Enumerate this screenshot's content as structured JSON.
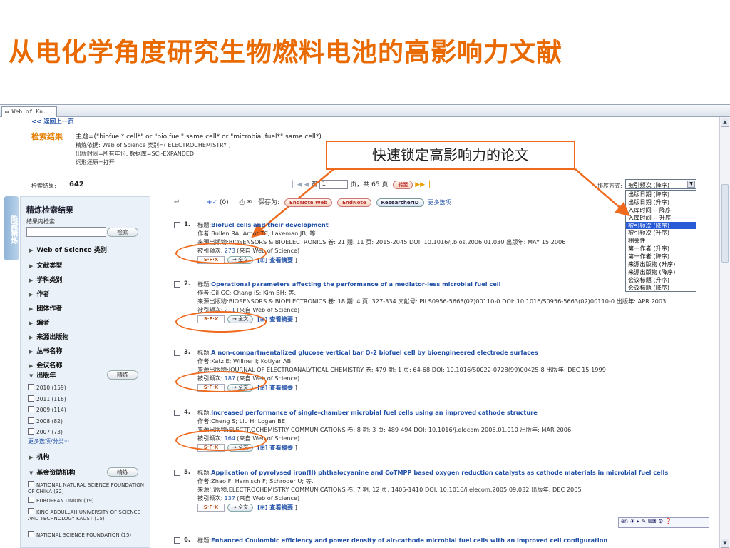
{
  "slide_title": "从电化学角度研究生物燃料电池的高影响力文献",
  "browser": {
    "tab_label": "Web of Kn..."
  },
  "back_link": "<< 返回上一页",
  "search_label": "检索结果",
  "query_line1": "主题=(\"biofuel* cell*\" or \"bio fuel\" same cell* or \"microbial fuel*\" same cell*)",
  "query_line2": "精炼依据: Web of Science 类别=( ELECTROCHEMISTRY )",
  "query_line3": "出版时间=所有年份. 数据库=SCI-EXPANDED.",
  "query_line4": "词形还原=打开",
  "results_label": "检索结果:",
  "results_count": "642",
  "pager": {
    "prefix": "第",
    "page": "1",
    "middle": "页，共 65 页",
    "go": "转至"
  },
  "sort_label": "排序方式:",
  "sort_selected": "被引频次 (降序)",
  "sort_options": [
    "出版日期 (降序)",
    "出版日期 (升序)",
    "入库时间 -- 降序",
    "入库时间 -- 升序",
    "被引频次 (降序)",
    "被引频次 (升序)",
    "相关性",
    "第一作者 (升序)",
    "第一作者 (降序)",
    "来源出版物 (升序)",
    "来源出版物 (降序)",
    "会议标题 (升序)",
    "会议标题 (降序)"
  ],
  "callout": "快速锁定高影响力的论文",
  "toolbar": {
    "count": "(0)",
    "save_label": "保存为:",
    "endnote_web": "EndNote Web",
    "endnote": "EndNote",
    "researcherid": "ResearcherID",
    "more": "更多选项"
  },
  "left_strip": "隐藏精炼",
  "refine": {
    "title": "精炼检索结果",
    "within_label": "结果内检索",
    "search_btn": "检索",
    "items": [
      "Web of Science 类别",
      "文献类型",
      "学科类别",
      "作者",
      "团体作者",
      "编者",
      "来源出版物",
      "丛书名称",
      "会议名称"
    ],
    "pubyear_label": "出版年",
    "refine_btn": "精炼",
    "years": [
      "2010 (159)",
      "2011 (116)",
      "2009 (114)",
      "2008 (82)",
      "2007 (73)"
    ],
    "more_options": "更多选项/分类···",
    "org_label": "机构",
    "funding_label": "基金资助机构",
    "funders": [
      "NATIONAL NATURAL SCIENCE FOUNDATION OF CHINA (32)",
      "EUROPEAN UNION (19)",
      "KING ABDULLAH UNIVERSITY OF SCIENCE AND TECHNOLOGY KAUST (15)",
      "NATIONAL SCIENCE FOUNDATION (15)"
    ]
  },
  "labels": {
    "title": "标题:",
    "author": "作者:",
    "source": "来源出版物:",
    "cited": "被引频次:",
    "cited_suffix": "(来自 Web of Science)",
    "fulltext": "全文",
    "abstract": "查看摘要"
  },
  "records": [
    {
      "num": "1.",
      "title": "Biofuel cells and their development",
      "authors": "Bullen RA; Arnot TC; Lakeman JB; 等.",
      "source": "BIOSENSORS & BIOELECTRONICS  卷: 21  期: 11  页: 2015-2045  DOI: 10.1016/j.bios.2006.01.030  出版年: MAY 15 2006",
      "cited": "273"
    },
    {
      "num": "2.",
      "title": "Operational parameters affecting the performance of a mediator-less microbial fuel cell",
      "authors": "Gil GC; Chang IS; Kim BH; 等.",
      "source": "BIOSENSORS & BIOELECTRONICS  卷: 18  期: 4  页: 327-334  文献号: PII S0956-5663(02)00110-0  DOI: 10.1016/S0956-5663(02)00110-0  出版年: APR 2003",
      "cited": "211"
    },
    {
      "num": "3.",
      "title": "A non-compartmentalized glucose vertical bar O-2 biofuel cell by bioengineered electrode surfaces",
      "authors": "Katz E; Willner I; Kotlyar AB",
      "source": "JOURNAL OF ELECTROANALYTICAL CHEMISTRY  卷: 479  期: 1  页: 64-68  DOI: 10.1016/S0022-0728(99)00425-8  出版年: DEC 15 1999",
      "cited": "187"
    },
    {
      "num": "4.",
      "title": "Increased performance of single-chamber microbial fuel cells using an improved cathode structure",
      "authors": "Cheng S; Liu H; Logan BE",
      "source": "ELECTROCHEMISTRY COMMUNICATIONS  卷: 8  期: 3  页: 489-494  DOI: 10.1016/j.elecom.2006.01.010  出版年: MAR 2006",
      "cited": "164"
    },
    {
      "num": "5.",
      "title": "Application of pyrolysed iron(II) phthalocyanine and CoTMPP based oxygen reduction catalysts as cathode materials in microbial fuel cells",
      "authors": "Zhao F; Harnisch F; Schroder U; 等.",
      "source": "ELECTROCHEMISTRY COMMUNICATIONS  卷: 7  期: 12  页: 1405-1410  DOI: 10.1016/j.elecom.2005.09.032  出版年: DEC 2005",
      "cited": "137"
    },
    {
      "num": "6.",
      "title": "Enhanced Coulombic efficiency and power density of air-cathode microbial fuel cells with an improved cell configuration"
    }
  ],
  "colors": {
    "title_orange": "#e86a00",
    "annotation": "#ef6a1c",
    "link_blue": "#1f4fa6",
    "panel_bg": "#eaf1f8",
    "select_blue": "#2a5bd7"
  }
}
